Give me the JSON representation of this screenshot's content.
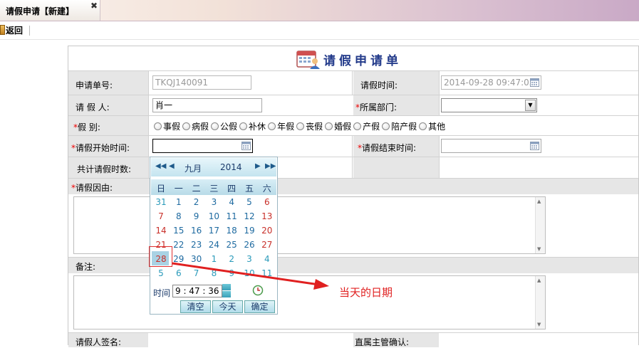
{
  "tab": {
    "title": "请假申请【新建】",
    "close": "✖"
  },
  "toolbar": {
    "back_label": "返回"
  },
  "form": {
    "title": "请假申请单",
    "request_no_label": "申请单号:",
    "request_no_value": "TKQJ140091",
    "request_time_label": "请假时间:",
    "request_time_value": "2014-09-28 09:47:05",
    "applicant_label": "请 假 人:",
    "applicant_value": "肖一",
    "dept_label": "所属部门:",
    "dept_value": "",
    "type_label": "假    别:",
    "leave_types": [
      "事假",
      "病假",
      "公假",
      "补休",
      "年假",
      "丧假",
      "婚假",
      "产假",
      "陪产假",
      "其他"
    ],
    "start_label": "请假开始时间:",
    "end_label": "请假结束时间:",
    "total_label": "共计请假时数:",
    "reason_label": "请假因由:",
    "remarks_label": "备注:",
    "signature_label": "请假人签名:",
    "supervisor_label": "直属主管确认:",
    "required_mark": "*"
  },
  "calendar": {
    "month": "九月",
    "year": "2014",
    "weekdays": [
      "日",
      "一",
      "二",
      "三",
      "四",
      "五",
      "六"
    ],
    "weeks": [
      [
        "31",
        "1",
        "2",
        "3",
        "4",
        "5",
        "6"
      ],
      [
        "7",
        "8",
        "9",
        "10",
        "11",
        "12",
        "13"
      ],
      [
        "14",
        "15",
        "16",
        "17",
        "18",
        "19",
        "20"
      ],
      [
        "21",
        "22",
        "23",
        "24",
        "25",
        "26",
        "27"
      ],
      [
        "28",
        "29",
        "30",
        "1",
        "2",
        "3",
        "4"
      ],
      [
        "5",
        "6",
        "7",
        "8",
        "9",
        "10",
        "11"
      ]
    ],
    "today": "28",
    "time_label": "时间",
    "time_value": "9 : 47 : 36",
    "clear_label": "清空",
    "today_label": "今天",
    "ok_label": "确定"
  },
  "annotation": "当天的日期",
  "colors": {
    "accent": "#223a8a",
    "required": "#e00000",
    "annotation": "#e02020",
    "weekend": "#c8302a"
  }
}
